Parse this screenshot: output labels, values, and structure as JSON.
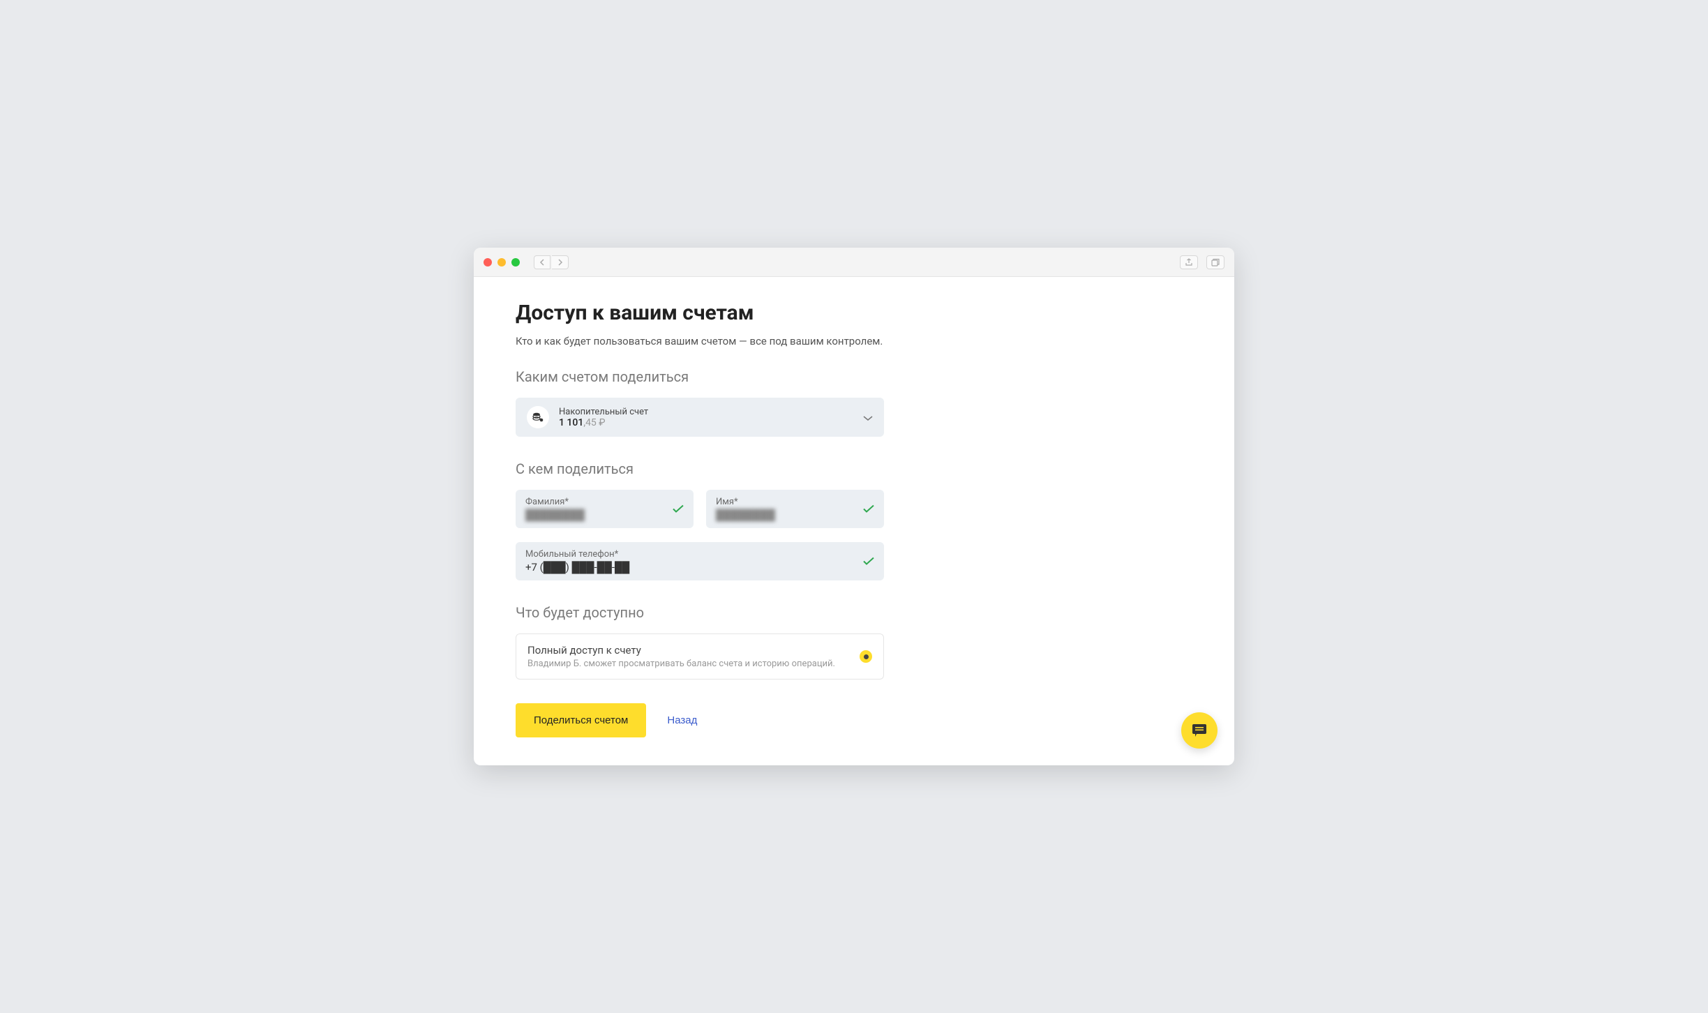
{
  "page": {
    "title": "Доступ к вашим счетам",
    "subtitle": "Кто и как будет пользоваться вашим счетом — все под вашим контролем."
  },
  "sections": {
    "account_share": {
      "heading": "Каким счетом поделиться",
      "account": {
        "label": "Накопительный счет",
        "balance_main": "1 101",
        "balance_cents": ",45 ₽"
      }
    },
    "share_with": {
      "heading": "С кем поделиться",
      "fields": {
        "surname": {
          "label": "Фамилия*",
          "value": "████████"
        },
        "name": {
          "label": "Имя*",
          "value": "████████"
        },
        "phone": {
          "label": "Мобильный телефон*",
          "value": "+7 (███) ███-██-██"
        }
      }
    },
    "permissions": {
      "heading": "Что будет доступно",
      "item": {
        "title": "Полный доступ к счету",
        "desc": "Владимир Б. сможет просматривать баланс счета и историю операций."
      }
    }
  },
  "actions": {
    "primary": "Поделиться счетом",
    "back": "Назад"
  }
}
